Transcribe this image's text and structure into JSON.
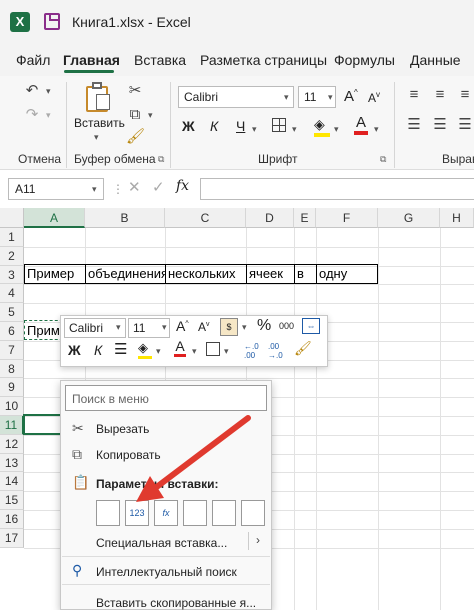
{
  "window": {
    "title": "Книга1.xlsx  -  Excel",
    "logo": "X"
  },
  "tabs": [
    "Файл",
    "Главная",
    "Вставка",
    "Разметка страницы",
    "Формулы",
    "Данные"
  ],
  "ribbon": {
    "groups": {
      "undo": "Отмена",
      "clipboard": "Буфер обмена",
      "font": "Шрифт",
      "align": "Выравн"
    },
    "paste_label": "Вставить",
    "font_name": "Calibri",
    "font_size": "11",
    "bold": "Ж",
    "italic": "К",
    "underline": "Ч",
    "grow": "A",
    "shrink": "A",
    "font_color_letter": "A"
  },
  "formula_bar": {
    "cell_ref": "A11",
    "fx": "fx",
    "value": ""
  },
  "columns": [
    "A",
    "B",
    "C",
    "D",
    "E",
    "F",
    "G",
    "H"
  ],
  "rows": [
    "1",
    "2",
    "3",
    "4",
    "5",
    "6",
    "7",
    "8",
    "9",
    "10",
    "11",
    "12",
    "13",
    "14",
    "15",
    "16",
    "17"
  ],
  "cells": {
    "r3": [
      "Пример",
      "объединения",
      "нескольких",
      "ячеек",
      "в",
      "одну"
    ],
    "r6": "Прим"
  },
  "mini_toolbar": {
    "font_name": "Calibri",
    "font_size": "11",
    "percent": "%",
    "thousands": "000",
    "bold": "Ж",
    "italic": "К",
    "font_color_letter": "A"
  },
  "context_menu": {
    "search_placeholder": "Поиск в меню",
    "items": {
      "cut": "Вырезать",
      "copy": "Копировать",
      "paste_options": "Параметры вставки:",
      "paste_special": "Специальная вставка...",
      "smart_lookup": "Интеллектуальный поиск",
      "insert_copied": "Вставить скопированные я..."
    },
    "paste_icons": [
      "paste-icon",
      "paste-values-icon",
      "paste-formulas-icon",
      "paste-transpose-icon",
      "paste-formatting-icon",
      "paste-link-icon"
    ],
    "paste_glyphs": [
      "",
      "123",
      "fx",
      "",
      "",
      ""
    ]
  },
  "annotation": {
    "arrow_color": "#e03a2f"
  },
  "colors": {
    "excel_green": "#1e7145",
    "selection_fill": "#d3e3d8"
  }
}
